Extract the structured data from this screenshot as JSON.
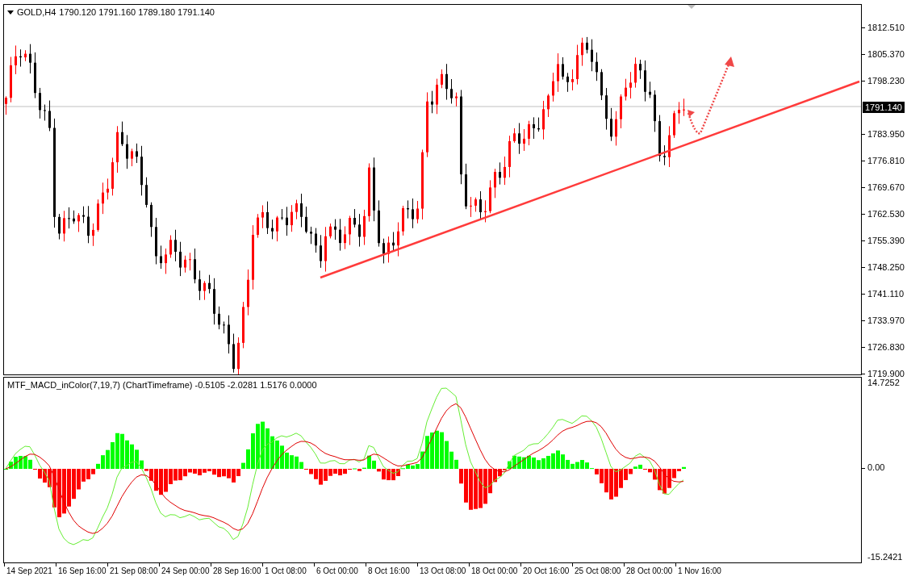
{
  "price_chart": {
    "header": {
      "symbol": "GOLD,H4",
      "ohlc": "1790.120 1791.160 1789.180 1791.140"
    },
    "price_axis": [
      "1812.510",
      "1805.370",
      "1798.230",
      "1783.950",
      "1776.810",
      "1769.670",
      "1762.530",
      "1755.390",
      "1748.250",
      "1741.110",
      "1733.970",
      "1726.830",
      "1719.900"
    ],
    "current_price": "1791.140"
  },
  "indicator": {
    "header": "MTF_MACD_inColor(7,19,7) (ChartTimeframe) -0.5105 -2.0281 1.5176 0.0000",
    "axis": [
      "14.7252",
      "0.00",
      "-15.2421"
    ]
  },
  "time_axis": [
    "14 Sep 2021",
    "16 Sep 16:00",
    "21 Sep 08:00",
    "24 Sep 00:00",
    "28 Sep 16:00",
    "1 Oct 08:00",
    "6 Oct 00:00",
    "8 Oct 16:00",
    "13 Oct 08:00",
    "18 Oct 00:00",
    "20 Oct 16:00",
    "25 Oct 08:00",
    "28 Oct 00:00",
    "1 Nov 16:00"
  ]
}
